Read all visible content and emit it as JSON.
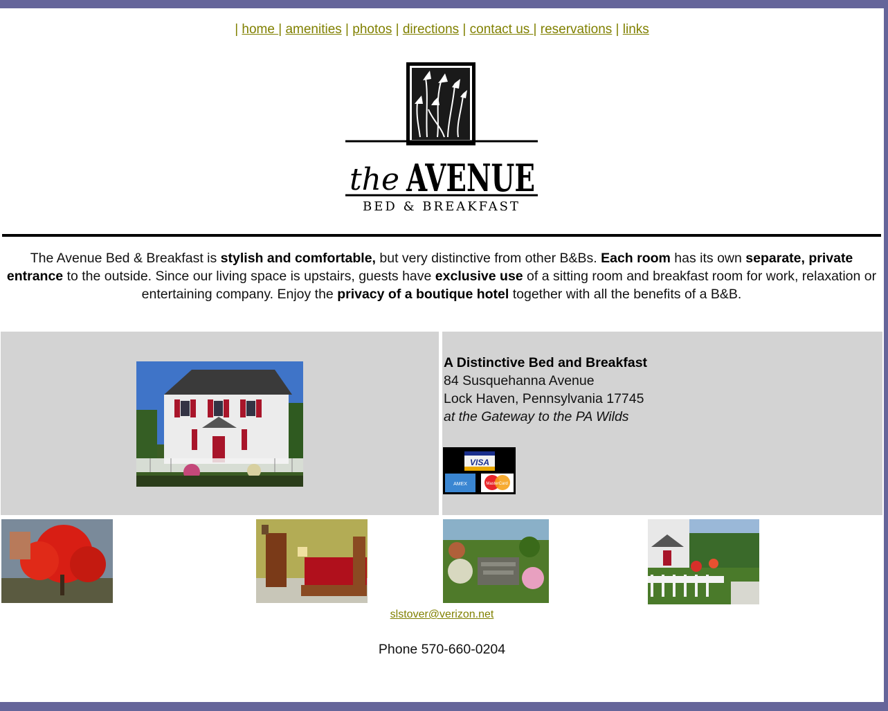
{
  "nav": {
    "links": [
      "home ",
      "amenities",
      "photos",
      "directions",
      "contact us ",
      "reservations",
      "links"
    ]
  },
  "logo": {
    "word_the": "the",
    "word_avenue": "AVENUE",
    "subtitle": "BED & BREAKFAST"
  },
  "intro": {
    "p1": "The Avenue Bed & Breakfast is ",
    "b1": "stylish and comfortable,",
    "p2": " but very distinctive from other B&Bs. ",
    "b2": "Each room",
    "p3": " has its own ",
    "b3": "separate, private entrance",
    "p4": " to the outside. Since our living space is upstairs, guests have ",
    "b4": "exclusive use",
    "p5": " of a sitting room and breakfast room for work, relaxation or entertaining company.  Enjoy the ",
    "b5": "privacy of a boutique hotel",
    "p6": " together with all the benefits of a B&B."
  },
  "address": {
    "name": "A Distinctive Bed and Breakfast",
    "street": "84 Susquehanna Avenue",
    "city": "Lock Haven, Pennsylvania 17745",
    "tagline": "at the Gateway to the PA Wilds"
  },
  "cards": {
    "visa": "VISA",
    "amex": "AMEX",
    "mastercard": "MasterCard"
  },
  "contact": {
    "email": "slstover@verizon.net",
    "phone": "Phone 570-660-0204"
  },
  "colors": {
    "frame": "#65659a",
    "link": "#808000",
    "panel": "#d3d3d3"
  }
}
